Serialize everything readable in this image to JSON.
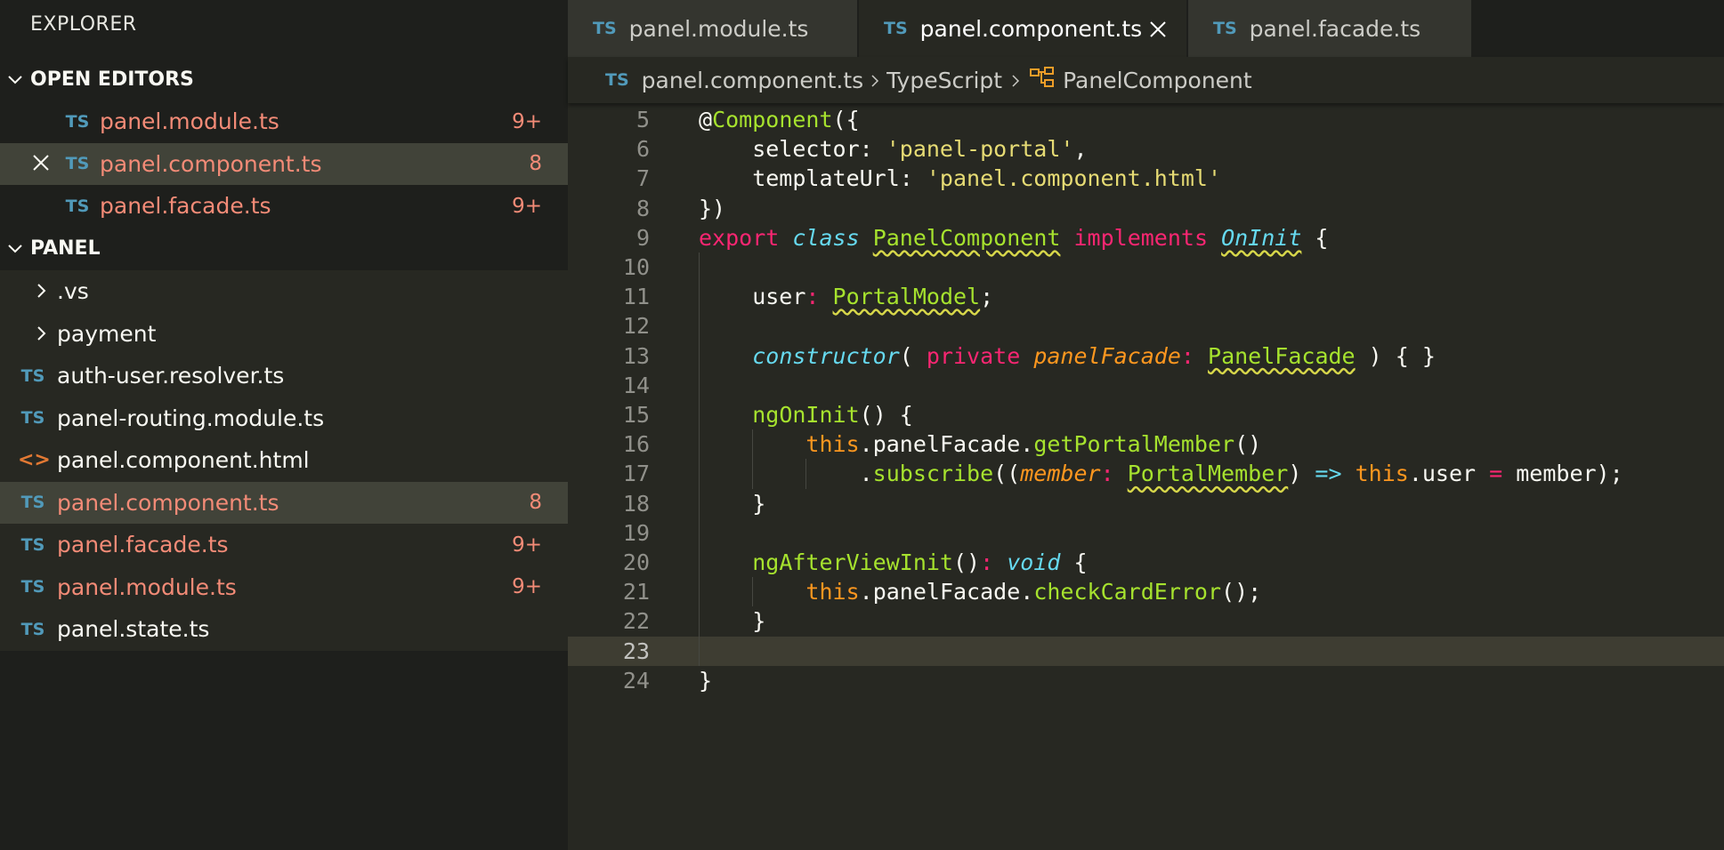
{
  "sidebar": {
    "title": "EXPLORER",
    "open_editors": {
      "heading": "OPEN EDITORS",
      "items": [
        {
          "lang": "TS",
          "name": "panel.module.ts",
          "badge": "9+"
        },
        {
          "lang": "TS",
          "name": "panel.component.ts",
          "badge": "8"
        },
        {
          "lang": "TS",
          "name": "panel.facade.ts",
          "badge": "9+"
        }
      ]
    },
    "panel": {
      "heading": "PANEL",
      "items": [
        {
          "name": ".vs"
        },
        {
          "name": "payment"
        },
        {
          "lang": "TS",
          "name": "auth-user.resolver.ts"
        },
        {
          "lang": "TS",
          "name": "panel-routing.module.ts"
        },
        {
          "lang": "<>",
          "name": "panel.component.html"
        },
        {
          "lang": "TS",
          "name": "panel.component.ts",
          "badge": "8"
        },
        {
          "lang": "TS",
          "name": "panel.facade.ts",
          "badge": "9+"
        },
        {
          "lang": "TS",
          "name": "panel.module.ts",
          "badge": "9+"
        },
        {
          "lang": "TS",
          "name": "panel.state.ts"
        }
      ]
    }
  },
  "tabs": [
    {
      "lang": "TS",
      "label": "panel.module.ts"
    },
    {
      "lang": "TS",
      "label": "panel.component.ts"
    },
    {
      "lang": "TS",
      "label": "panel.facade.ts"
    }
  ],
  "breadcrumb": {
    "lang": "TS",
    "file": "panel.component.ts",
    "language": "TypeScript",
    "symbol": "PanelComponent"
  },
  "editor": {
    "line_numbers": [
      "5",
      "6",
      "7",
      "8",
      "9",
      "10",
      "11",
      "12",
      "13",
      "14",
      "15",
      "16",
      "17",
      "18",
      "19",
      "20",
      "21",
      "22",
      "23",
      "24"
    ],
    "lines": [
      [
        [
          "",
          "@"
        ],
        [
          "g",
          "Component"
        ],
        [
          "",
          "({"
        ]
      ],
      [
        [
          "",
          "    selector: "
        ],
        [
          "s",
          "'panel-portal'"
        ],
        [
          "",
          ","
        ]
      ],
      [
        [
          "",
          "    templateUrl: "
        ],
        [
          "s",
          "'panel.component.html'"
        ]
      ],
      [
        [
          "",
          "})"
        ]
      ],
      [
        [
          "k",
          "export"
        ],
        [
          "",
          " "
        ],
        [
          "c",
          "class"
        ],
        [
          "",
          " "
        ],
        [
          "g u",
          "PanelComponent"
        ],
        [
          "",
          " "
        ],
        [
          "k",
          "implements"
        ],
        [
          "",
          " "
        ],
        [
          "g c u",
          "OnInit"
        ],
        [
          "",
          " {"
        ]
      ],
      [],
      [
        [
          "",
          "    user"
        ],
        [
          "k",
          ":"
        ],
        [
          "",
          " "
        ],
        [
          "g u",
          "PortalModel"
        ],
        [
          "",
          ";"
        ]
      ],
      [],
      [
        [
          "",
          "    "
        ],
        [
          "c",
          "constructor"
        ],
        [
          "",
          "( "
        ],
        [
          "k",
          "private"
        ],
        [
          "",
          " "
        ],
        [
          "p",
          "panelFacade"
        ],
        [
          "k",
          ":"
        ],
        [
          "",
          " "
        ],
        [
          "g u",
          "PanelFacade"
        ],
        [
          "",
          " ) { }"
        ]
      ],
      [],
      [
        [
          "",
          "    "
        ],
        [
          "g",
          "ngOnInit"
        ],
        [
          "",
          "() {"
        ]
      ],
      [
        [
          "",
          "        "
        ],
        [
          "th",
          "this"
        ],
        [
          "",
          ".panelFacade."
        ],
        [
          "g",
          "getPortalMember"
        ],
        [
          "",
          "()"
        ]
      ],
      [
        [
          "",
          "            ."
        ],
        [
          "g",
          "subscribe"
        ],
        [
          "",
          "(("
        ],
        [
          "p",
          "member"
        ],
        [
          "k",
          ":"
        ],
        [
          "",
          " "
        ],
        [
          "g u",
          "PortalMember"
        ],
        [
          "",
          ") "
        ],
        [
          "c",
          "=>"
        ],
        [
          "",
          " "
        ],
        [
          "th",
          "this"
        ],
        [
          "",
          ".user "
        ],
        [
          "k",
          "="
        ],
        [
          "",
          " member);"
        ]
      ],
      [
        [
          "",
          "    }"
        ]
      ],
      [],
      [
        [
          "",
          "    "
        ],
        [
          "g",
          "ngAfterViewInit"
        ],
        [
          "",
          "()"
        ],
        [
          "k",
          ":"
        ],
        [
          "",
          " "
        ],
        [
          "c",
          "void"
        ],
        [
          "",
          " {"
        ]
      ],
      [
        [
          "",
          "        "
        ],
        [
          "th",
          "this"
        ],
        [
          "",
          ".panelFacade."
        ],
        [
          "g",
          "checkCardError"
        ],
        [
          "",
          "();"
        ]
      ],
      [
        [
          "",
          "    }"
        ]
      ],
      [],
      [
        [
          "",
          "}"
        ]
      ]
    ]
  }
}
